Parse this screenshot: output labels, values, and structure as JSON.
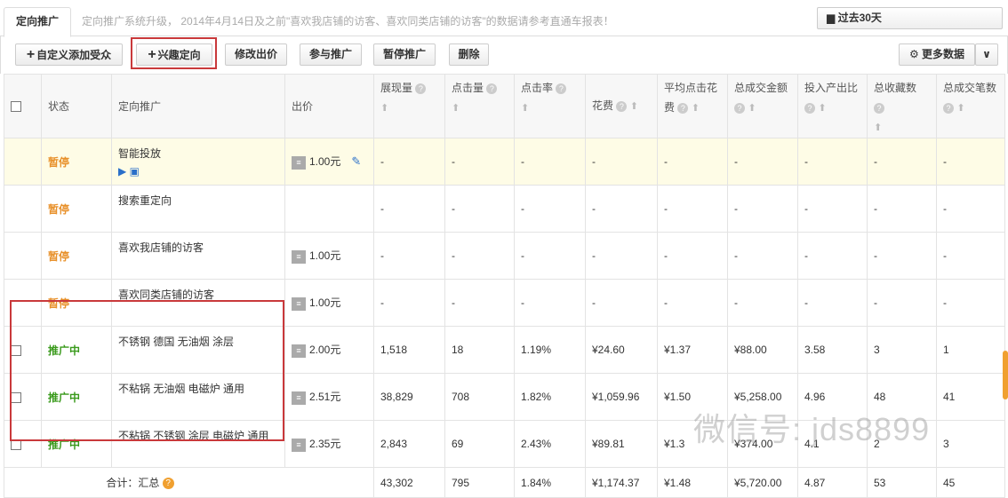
{
  "tab": "定向推广",
  "notice": "定向推广系统升级， 2014年4月14日及之前\"喜欢我店铺的访客、喜欢同类店铺的访客\"的数据请参考直通车报表！",
  "date_range": "过去30天",
  "toolbar": {
    "add_audience": "自定义添加受众",
    "interest": "兴趣定向",
    "edit_bid": "修改出价",
    "join": "参与推广",
    "pause": "暂停推广",
    "delete": "删除",
    "more_data": "更多数据"
  },
  "columns": [
    "状态",
    "定向推广",
    "出价",
    "展现量",
    "点击量",
    "点击率",
    "花费",
    "平均点击花费",
    "总成交金额",
    "投入产出比",
    "总收藏数",
    "总成交笔数"
  ],
  "rows": [
    {
      "status": "暂停",
      "name": "智能投放",
      "bid": "1.00元",
      "v": [
        "-",
        "-",
        "-",
        "-",
        "-",
        "-",
        "-",
        "-",
        "-"
      ]
    },
    {
      "status": "暂停",
      "name": "搜索重定向",
      "bid": "",
      "v": [
        "-",
        "-",
        "-",
        "-",
        "-",
        "-",
        "-",
        "-",
        "-"
      ]
    },
    {
      "status": "暂停",
      "name": "喜欢我店铺的访客",
      "bid": "1.00元",
      "v": [
        "-",
        "-",
        "-",
        "-",
        "-",
        "-",
        "-",
        "-",
        "-"
      ]
    },
    {
      "status": "暂停",
      "name": "喜欢同类店铺的访客",
      "bid": "1.00元",
      "v": [
        "-",
        "-",
        "-",
        "-",
        "-",
        "-",
        "-",
        "-",
        "-"
      ]
    },
    {
      "status": "推广中",
      "name": "不锈钢 德国 无油烟 涂层",
      "bid": "2.00元",
      "v": [
        "1,518",
        "18",
        "1.19%",
        "¥24.60",
        "¥1.37",
        "¥88.00",
        "3.58",
        "3",
        "1"
      ]
    },
    {
      "status": "推广中",
      "name": "不粘锅 无油烟 电磁炉 通用",
      "bid": "2.51元",
      "v": [
        "38,829",
        "708",
        "1.82%",
        "¥1,059.96",
        "¥1.50",
        "¥5,258.00",
        "4.96",
        "48",
        "41"
      ]
    },
    {
      "status": "推广中",
      "name": "不粘锅 不锈钢 涂层 电磁炉 通用",
      "bid": "2.35元",
      "v": [
        "2,843",
        "69",
        "2.43%",
        "¥89.81",
        "¥1.3",
        "¥374.00",
        "4.1",
        "2",
        "3"
      ]
    }
  ],
  "total": {
    "label": "合计：汇总",
    "v": [
      "43,302",
      "795",
      "1.84%",
      "¥1,174.37",
      "¥1.48",
      "¥5,720.00",
      "4.87",
      "53",
      "45"
    ]
  },
  "watermark": "微信号: jds8899",
  "colors": {
    "paused": "#e8912b",
    "active": "#3a9a1c",
    "highlight": "#c9393b"
  }
}
